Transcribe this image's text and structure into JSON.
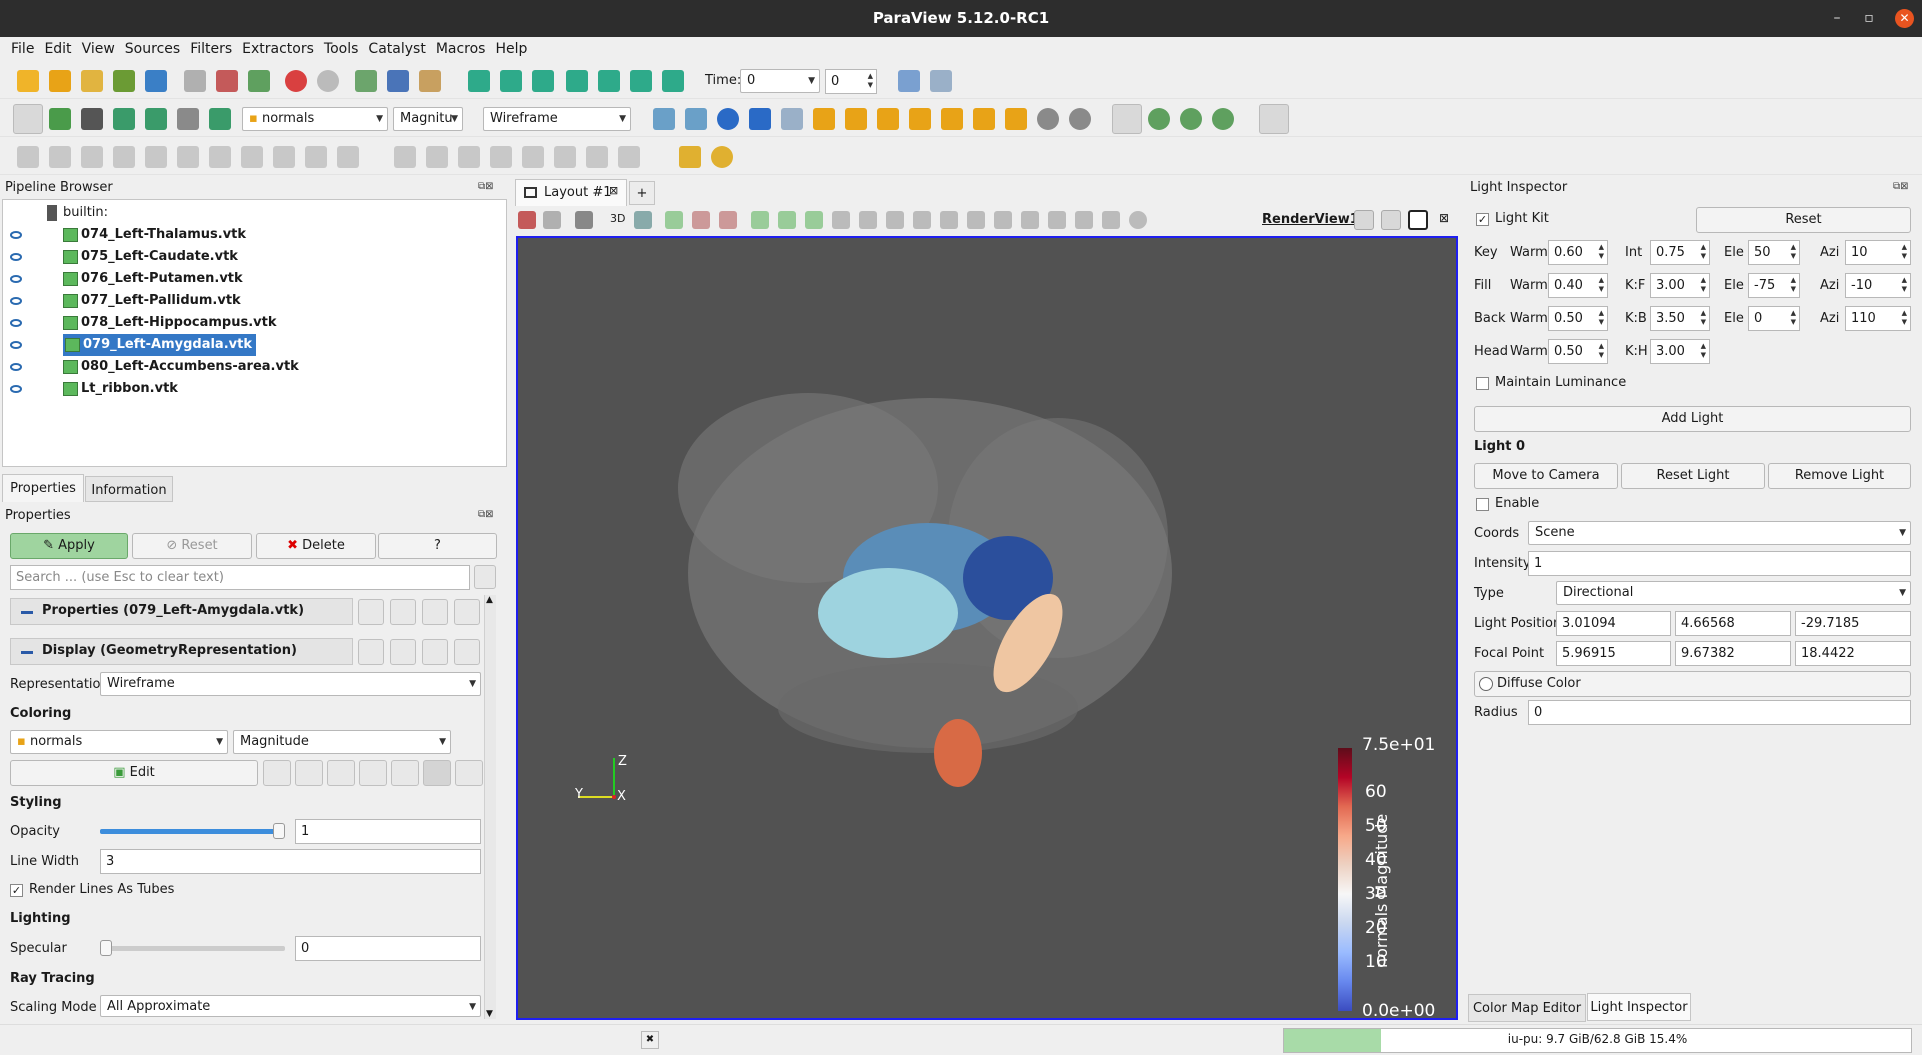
{
  "window": {
    "title": "ParaView 5.12.0-RC1",
    "min": "–",
    "max": "▫",
    "close": "✕"
  },
  "menu": [
    "File",
    "Edit",
    "View",
    "Sources",
    "Filters",
    "Extractors",
    "Tools",
    "Catalyst",
    "Macros",
    "Help"
  ],
  "time": {
    "label": "Time:",
    "value": "0",
    "index": "0"
  },
  "toolbar2": {
    "color_array": "normals",
    "component": "Magnitu",
    "representation": "Wireframe"
  },
  "pipeline": {
    "title": "Pipeline Browser",
    "root": "builtin:",
    "items": [
      {
        "label": "074_Left-Thalamus.vtk",
        "selected": false
      },
      {
        "label": "075_Left-Caudate.vtk",
        "selected": false
      },
      {
        "label": "076_Left-Putamen.vtk",
        "selected": false
      },
      {
        "label": "077_Left-Pallidum.vtk",
        "selected": false
      },
      {
        "label": "078_Left-Hippocampus.vtk",
        "selected": false
      },
      {
        "label": "079_Left-Amygdala.vtk",
        "selected": true
      },
      {
        "label": "080_Left-Accumbens-area.vtk",
        "selected": false
      },
      {
        "label": "Lt_ribbon.vtk",
        "selected": false
      }
    ]
  },
  "props": {
    "tab_properties": "Properties",
    "tab_information": "Information",
    "title": "Properties",
    "apply": "Apply",
    "reset": "Reset",
    "delete": "Delete",
    "help": "?",
    "search_placeholder": "Search ... (use Esc to clear text)",
    "section_properties": "Properties (079_Left-Amygdala.vtk)",
    "section_display": "Display (GeometryRepresentation)",
    "representation_label": "Representation",
    "representation_value": "Wireframe",
    "coloring": "Coloring",
    "color_array": "normals",
    "color_component": "Magnitude",
    "edit": "Edit",
    "styling": "Styling",
    "opacity_label": "Opacity",
    "opacity_value": "1",
    "opacity_fraction": 1.0,
    "linewidth_label": "Line Width",
    "linewidth_value": "3",
    "tubes_label": "Render Lines As Tubes",
    "tubes_checked": true,
    "lighting": "Lighting",
    "specular_label": "Specular",
    "specular_value": "0",
    "specular_fraction": 0.0,
    "raytracing": "Ray Tracing",
    "scaling_label": "Scaling Mode",
    "scaling_value": "All Approximate"
  },
  "layout": {
    "tab": "Layout #1",
    "add": "+",
    "view3d": "3D",
    "view_name": "RenderView1"
  },
  "render": {
    "background": "#525252",
    "colorbar": {
      "title": "normals Magnitude",
      "max_label": "7.5e+01",
      "min_label": "0.0e+00",
      "ticks": [
        "60",
        "50",
        "40",
        "30",
        "20",
        "10"
      ]
    },
    "axes": {
      "z": "Z",
      "y": "Y",
      "x": "X"
    }
  },
  "light": {
    "title": "Light Inspector",
    "lightkit_label": "Light Kit",
    "lightkit_checked": true,
    "reset": "Reset",
    "rows": [
      {
        "name": "Key",
        "warm": "0.60",
        "ratio_label": "Int",
        "ratio": "0.75",
        "ele": "50",
        "azi": "10"
      },
      {
        "name": "Fill",
        "warm": "0.40",
        "ratio_label": "K:F",
        "ratio": "3.00",
        "ele": "-75",
        "azi": "-10"
      },
      {
        "name": "Back",
        "warm": "0.50",
        "ratio_label": "K:B",
        "ratio": "3.50",
        "ele": "0",
        "azi": "110"
      },
      {
        "name": "Head",
        "warm": "0.50",
        "ratio_label": "K:H",
        "ratio": "3.00"
      }
    ],
    "warm_label": "Warm",
    "ele_label": "Ele",
    "azi_label": "Azi",
    "maintain_label": "Maintain Luminance",
    "add_light": "Add Light",
    "light0": "Light 0",
    "move_to_camera": "Move to Camera",
    "reset_light": "Reset Light",
    "remove_light": "Remove Light",
    "enable_label": "Enable",
    "coords_label": "Coords",
    "coords_value": "Scene",
    "intensity_label": "Intensity",
    "intensity_value": "1",
    "type_label": "Type",
    "type_value": "Directional",
    "position_label": "Light Position",
    "position": [
      "3.01094",
      "4.66568",
      "-29.7185"
    ],
    "focal_label": "Focal Point",
    "focal": [
      "5.96915",
      "9.67382",
      "18.4422"
    ],
    "diffuse_label": "Diffuse Color",
    "radius_label": "Radius",
    "radius_value": "0"
  },
  "bottom_tabs": {
    "color_map": "Color Map Editor",
    "light_inspector": "Light Inspector"
  },
  "status": {
    "memory": "iu-pu: 9.7 GiB/62.8 GiB 15.4%",
    "memory_fraction": 0.154,
    "close": "✖"
  }
}
